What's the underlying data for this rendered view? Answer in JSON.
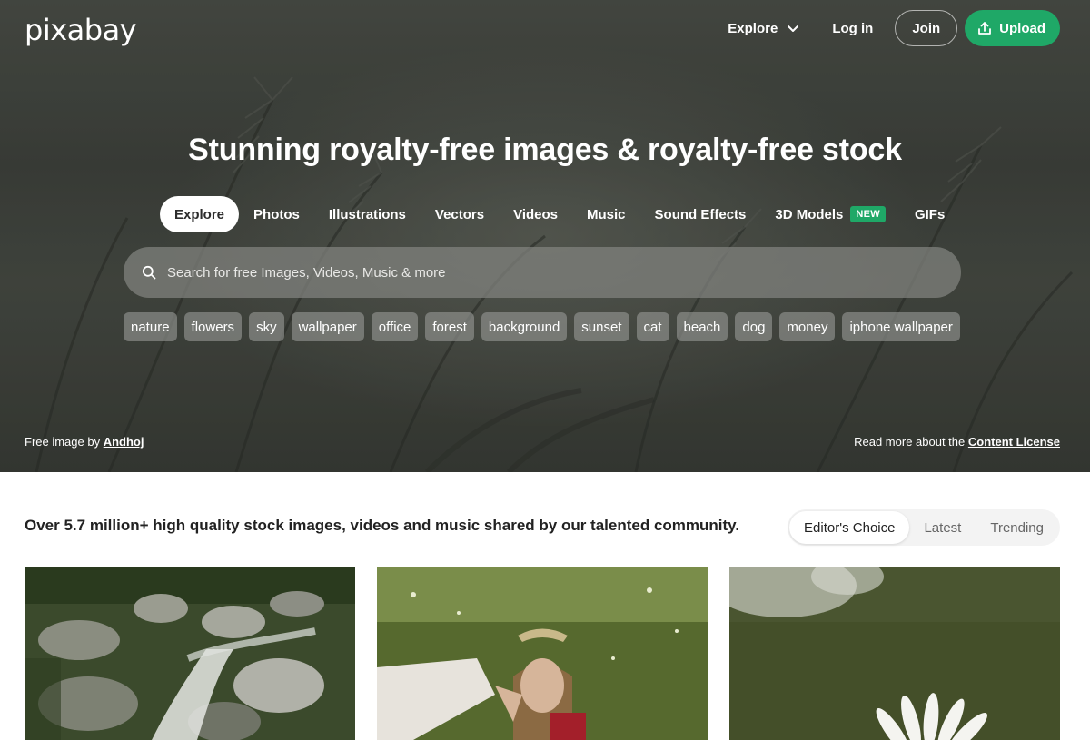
{
  "header": {
    "logo": "pixabay",
    "nav": {
      "explore": "Explore",
      "login": "Log in",
      "join": "Join",
      "upload": "Upload"
    }
  },
  "hero": {
    "headline": "Stunning royalty-free images & royalty-free stock",
    "categories": [
      {
        "label": "Explore"
      },
      {
        "label": "Photos"
      },
      {
        "label": "Illustrations"
      },
      {
        "label": "Vectors"
      },
      {
        "label": "Videos"
      },
      {
        "label": "Music"
      },
      {
        "label": "Sound Effects"
      },
      {
        "label": "3D Models",
        "badge": "NEW"
      },
      {
        "label": "GIFs"
      }
    ],
    "search": {
      "placeholder": "Search for free Images, Videos, Music & more"
    },
    "tags": [
      "nature",
      "flowers",
      "sky",
      "wallpaper",
      "office",
      "forest",
      "background",
      "sunset",
      "cat",
      "beach",
      "dog",
      "money",
      "iphone wallpaper"
    ],
    "credit": {
      "prefix": "Free image by",
      "author": "Andhoj"
    },
    "license": {
      "prefix": "Read more about the",
      "link": "Content License"
    }
  },
  "main": {
    "tagline": "Over 5.7 million+ high quality stock images, videos and music shared by our talented community.",
    "tabs": [
      {
        "label": "Editor's Choice",
        "active": true
      },
      {
        "label": "Latest"
      },
      {
        "label": "Trending"
      }
    ]
  },
  "colors": {
    "accent": "#1fa867",
    "text": "#222222"
  },
  "icons": {
    "explore_chevron": "chevron-down-icon",
    "upload": "upload-icon",
    "search": "search-icon"
  }
}
